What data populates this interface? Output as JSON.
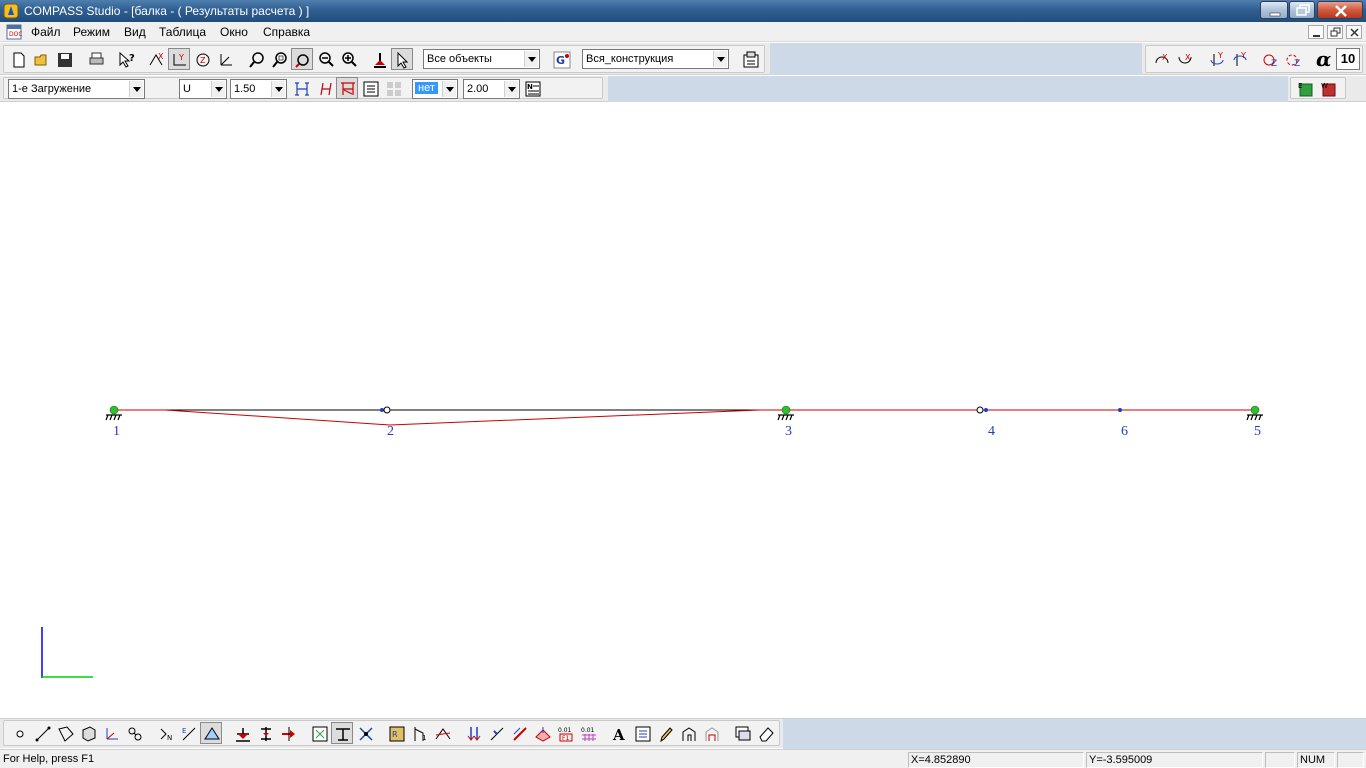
{
  "window": {
    "title": "COMPASS  Studio - [балка - ( Результаты расчета ) ]",
    "ghost_title": ""
  },
  "menu": {
    "items": [
      "Файл",
      "Режим",
      "Вид",
      "Таблица",
      "Окно",
      "Справка"
    ]
  },
  "toolbar_top": {
    "objects_filter": "Все объекты",
    "group_filter": "Вся_конструкция",
    "alpha_value": "10"
  },
  "toolbar_results": {
    "load_case": "1-е Загружение",
    "component": "U",
    "scale": "1.50",
    "option": "нет",
    "scale2": "2.00"
  },
  "canvas": {
    "nodes": [
      {
        "label": "1",
        "support": true
      },
      {
        "label": "2",
        "support": false
      },
      {
        "label": "3",
        "support": true
      },
      {
        "label": "4",
        "support": false
      },
      {
        "label": "6",
        "support": false
      },
      {
        "label": "5",
        "support": true
      }
    ],
    "colors": {
      "beam": "#000000",
      "deformation": "#cc0000",
      "node_label": "#1f3fbf",
      "support": "#2fbf2f",
      "axis_x": "#00d000",
      "axis_y": "#0000ff"
    }
  },
  "status": {
    "help": "For Help, press F1",
    "x_coord": "X=4.852890",
    "y_coord": "Y=-3.595009",
    "num": "NUM"
  }
}
